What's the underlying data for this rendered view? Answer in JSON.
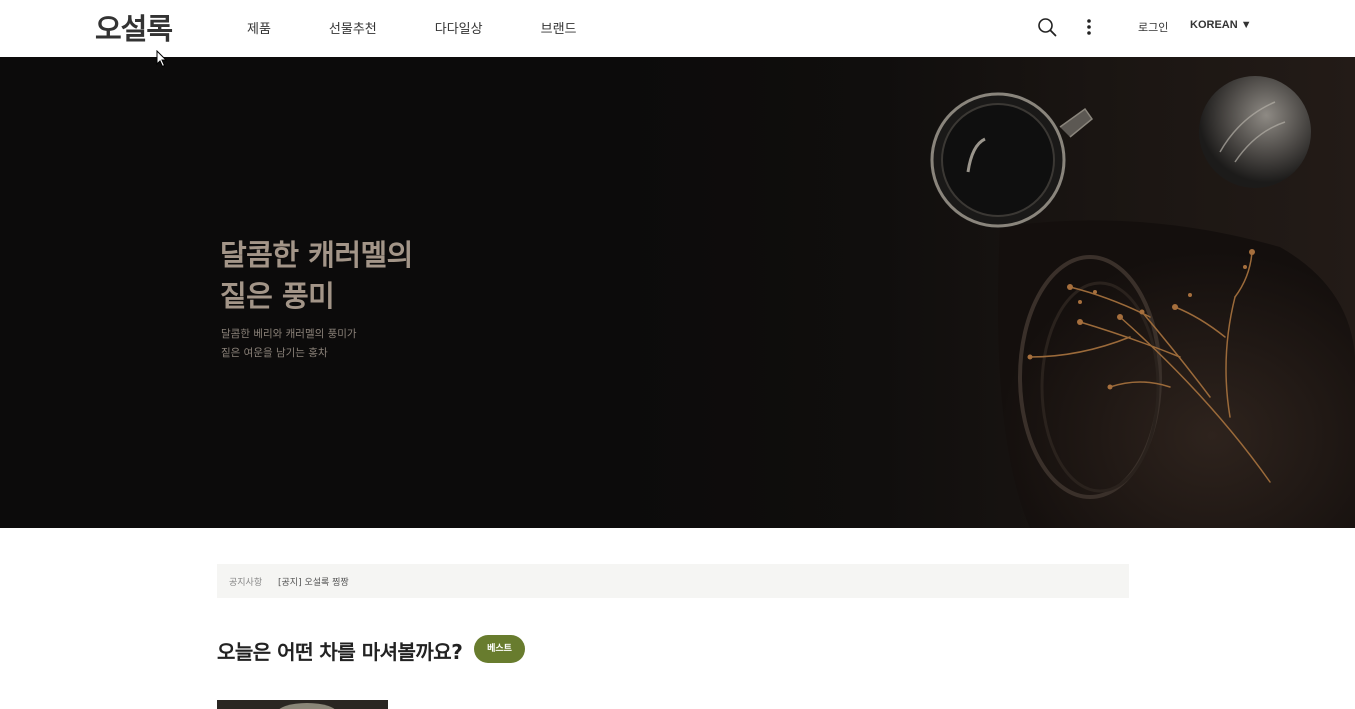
{
  "header": {
    "logo": "오설록",
    "nav": [
      "제품",
      "선물추천",
      "다다일상",
      "브랜드"
    ],
    "login": "로그인",
    "language": "KOREAN",
    "language_caret": "▼"
  },
  "hero": {
    "title_line1": "달콤한 캐러멜의",
    "title_line2": "짙은 풍미",
    "sub_line1": "달콤한 베리와 캐러멜의 풍미가",
    "sub_line2": "짙은 여운을 남기는 홍차"
  },
  "notice": {
    "label": "공지사항",
    "text": "[공지] 오설록 찡짱"
  },
  "section": {
    "title": "오늘은 어떤 차를 마셔볼까요?",
    "badge": "베스트"
  },
  "icons": [
    "search-icon",
    "more-vertical-icon",
    "cursor-icon"
  ],
  "colors": {
    "hero_bg": "#0c0b0b",
    "hero_title": "#a39588",
    "badge_bg": "#687c2e",
    "notice_bg": "#f5f5f3"
  }
}
